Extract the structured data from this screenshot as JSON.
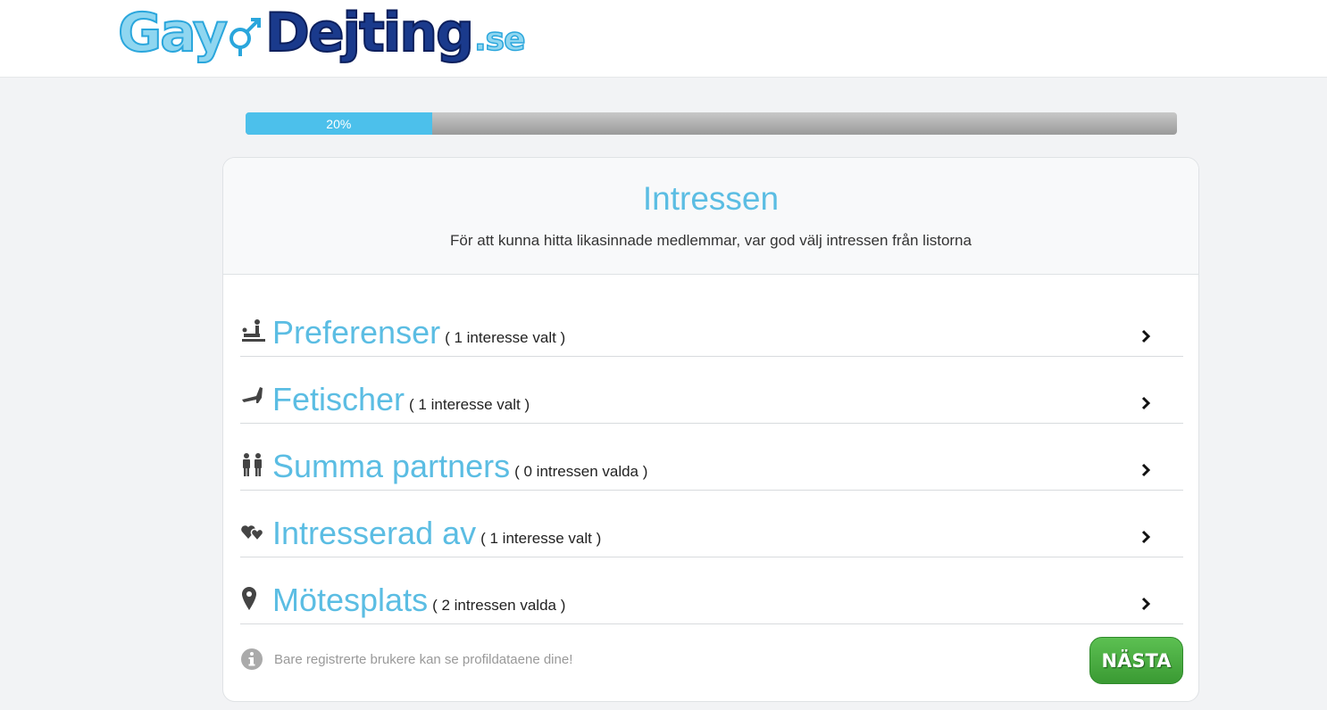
{
  "header": {
    "logo": {
      "part1": "Gay",
      "part2": "Dejting",
      "part3": ".se"
    }
  },
  "progress": {
    "value_percent": 20,
    "label": "20%"
  },
  "card": {
    "title": "Intressen",
    "subtitle": "För att kunna hitta likasinnade medlemmar, var god välj intressen från listorna",
    "rows": [
      {
        "icon": "preferences-icon",
        "title": "Preferenser",
        "count": "( 1 interesse valt )"
      },
      {
        "icon": "boot-icon",
        "title": "Fetischer",
        "count": "( 1 interesse valt )"
      },
      {
        "icon": "couple-icon",
        "title": "Summa partners",
        "count": "( 0 intressen valda )"
      },
      {
        "icon": "hearts-icon",
        "title": "Intresserad av",
        "count": "( 1 interesse valt )"
      },
      {
        "icon": "map-pin-icon",
        "title": "Mötesplats",
        "count": "( 2 intressen valda )"
      }
    ],
    "note": "Bare registrerte brukere kan se profildataene dine!",
    "next_label": "NÄSTA"
  },
  "colors": {
    "accent": "#5bbde3",
    "progress_fill": "#4cc0eb",
    "button_green": "#3a9a33",
    "icon_gray": "#444444"
  }
}
